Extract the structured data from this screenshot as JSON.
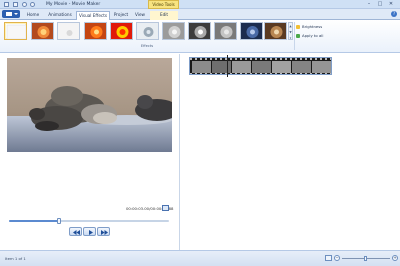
{
  "window": {
    "title": "My Movie - Movie Maker",
    "context_tab_group": "Video Tools",
    "controls": {
      "minimize": "–",
      "maximize": "□",
      "close": "✕"
    }
  },
  "quick_access": [
    {
      "icon": "save-icon"
    },
    {
      "icon": "undo-icon"
    },
    {
      "icon": "redo-icon"
    },
    {
      "icon": "dropdown-icon"
    }
  ],
  "tabs": [
    {
      "label": "Home",
      "active": false
    },
    {
      "label": "Animations",
      "active": false
    },
    {
      "label": "Visual Effects",
      "active": true
    },
    {
      "label": "Project",
      "active": false
    },
    {
      "label": "View",
      "active": false
    },
    {
      "label": "Edit",
      "active": false,
      "contextual": true
    }
  ],
  "ribbon": {
    "effects_group_label": "Effects",
    "effects": [
      {
        "name": "no-effect",
        "selected": true
      },
      {
        "name": "warm-tint"
      },
      {
        "name": "blur"
      },
      {
        "name": "orange-glow"
      },
      {
        "name": "threshold"
      },
      {
        "name": "cyan-tone"
      },
      {
        "name": "grayscale"
      },
      {
        "name": "black-white-high"
      },
      {
        "name": "black-white-low"
      },
      {
        "name": "blue-tone"
      },
      {
        "name": "sepia"
      }
    ],
    "brightness_label": "Brightness",
    "apply_all_label": "Apply to all"
  },
  "player": {
    "timecode": "00:00:03.00/00:00:06.88",
    "progress_fraction": 0.31
  },
  "status": {
    "text": "Item 1 of 1",
    "zoom_fraction": 0.48
  },
  "colors": {
    "accent": "#2c5fb0",
    "tab_bg": "#dfe9f7",
    "context_yellow": "#f8e480"
  }
}
